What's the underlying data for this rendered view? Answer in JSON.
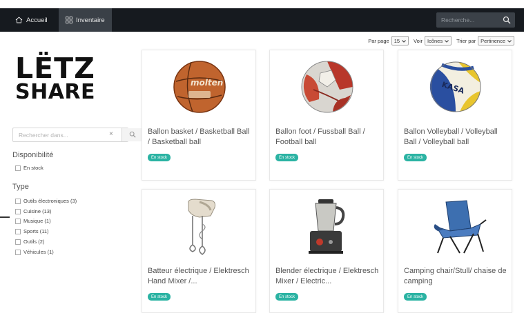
{
  "nav": {
    "home_label": "Accueil",
    "inventory_label": "Inventaire",
    "search_placeholder": "Recherche..."
  },
  "logo": {
    "line1": "LËTZ",
    "line2": "SHARE"
  },
  "sort": {
    "per_page_label": "Par page",
    "per_page_value": "15",
    "view_label": "Voir",
    "view_value": "Icônes",
    "sort_label": "Trier par",
    "sort_value": "Pertinence"
  },
  "sidebar": {
    "search_placeholder": "Rechercher dans...",
    "clear_symbol": "×",
    "availability_title": "Disponibilité",
    "availability_items": [
      "En stock"
    ],
    "type_title": "Type",
    "type_items": [
      "Outils électroniques (3)",
      "Cuisine (13)",
      "Musique (1)",
      "Sports (11)",
      "Outils (2)",
      "Véhicules (1)"
    ]
  },
  "products": [
    {
      "title": "Ballon basket / Basketball Ball / Basketball ball",
      "status": "En stock",
      "image_icon": "basketball-icon"
    },
    {
      "title": "Ballon foot / Fussball Ball / Football ball",
      "status": "En stock",
      "image_icon": "football-icon"
    },
    {
      "title": "Ballon Volleyball / Volleyball Ball / Volleyball ball",
      "status": "En stock",
      "image_icon": "volleyball-icon"
    },
    {
      "title": "Batteur électrique / Elektresch Hand Mixer /...",
      "status": "En stock",
      "image_icon": "hand-mixer-icon"
    },
    {
      "title": "Blender électrique / Elektresch Mixer / Electric...",
      "status": "En stock",
      "image_icon": "blender-icon"
    },
    {
      "title": "Camping chair/Stull/ chaise de camping",
      "status": "En stock",
      "image_icon": "camping-chair-icon"
    }
  ],
  "colors": {
    "navbar": "#161a1f",
    "active_tab": "#3a4047",
    "badge": "#2bb3a3"
  }
}
